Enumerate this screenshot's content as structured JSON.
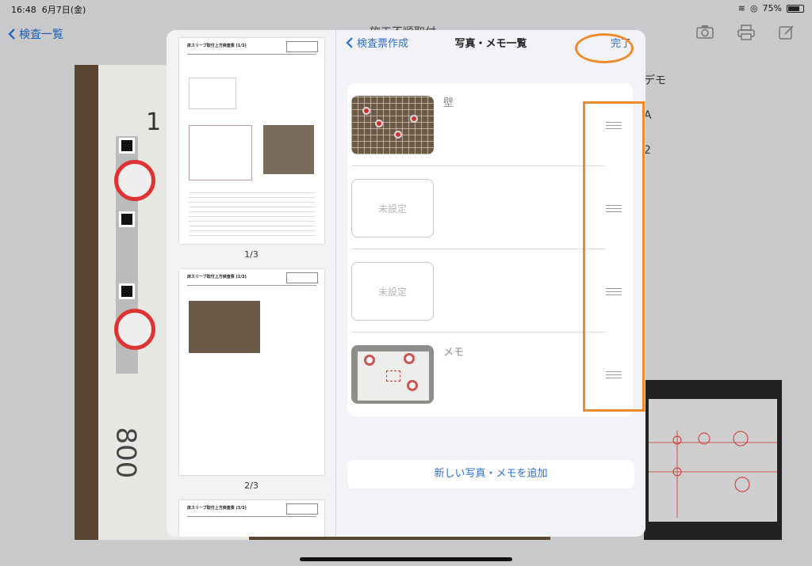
{
  "status_bar": {
    "time": "16:48",
    "date": "6月7日(金)",
    "battery": "75%"
  },
  "background": {
    "back_label": "検査一覧",
    "title_fragment": "施工不順取付",
    "list_items": [
      "デモ",
      "A",
      "2"
    ],
    "photo_text": {
      "one": "1",
      "eight_hundred": "800"
    }
  },
  "sheet": {
    "nav": {
      "back_label": "検査票作成",
      "title": "写真・メモ一覧",
      "done_label": "完了"
    },
    "thumbnails": {
      "pages": [
        {
          "title": "床スリーブ取付上方検査票 (1/3)",
          "label": "1/3"
        },
        {
          "title": "床スリーブ取付上方検査票 (2/3)",
          "label": "2/3"
        },
        {
          "title": "床スリーブ取付上方検査票 (3/3)",
          "label": ""
        }
      ]
    },
    "rows": [
      {
        "label": "壁",
        "thumb": "cage-photo"
      },
      {
        "label": "",
        "thumb_placeholder": "未設定"
      },
      {
        "label": "",
        "thumb_placeholder": "未設定"
      },
      {
        "label": "メモ",
        "thumb": "board-photo"
      }
    ],
    "add_button": "新しい写真・メモを追加"
  },
  "colors": {
    "accent": "#2f6fc9",
    "highlight": "#ef8a2b"
  }
}
